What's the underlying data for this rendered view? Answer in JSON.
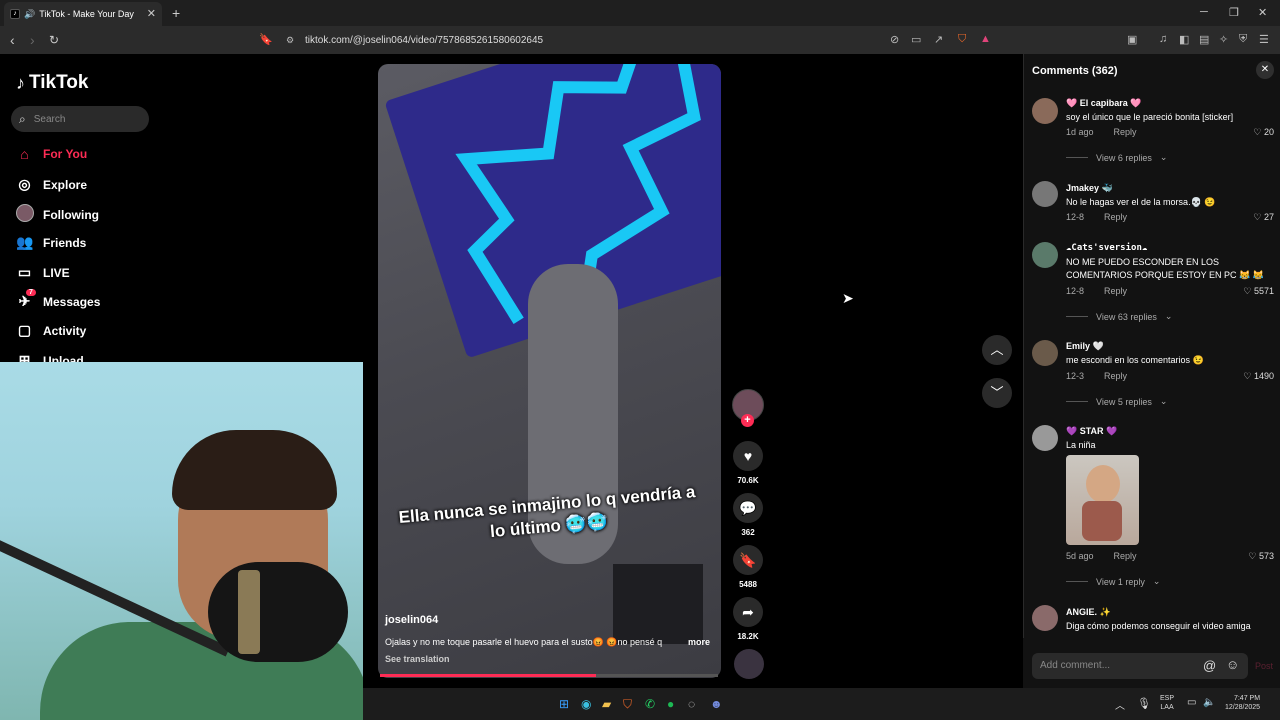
{
  "browser": {
    "tab_title": "TikTok - Make Your Day",
    "url": "tiktok.com/@joselin064/video/7578685261580602645"
  },
  "sidebar": {
    "logo": "TikTok",
    "search_placeholder": "Search",
    "items": [
      {
        "label": "For You",
        "icon": "home-icon",
        "active": true
      },
      {
        "label": "Explore",
        "icon": "compass-icon"
      },
      {
        "label": "Following",
        "icon": "avatar"
      },
      {
        "label": "Friends",
        "icon": "friends-icon"
      },
      {
        "label": "LIVE",
        "icon": "live-icon"
      },
      {
        "label": "Messages",
        "icon": "messages-icon",
        "badge": "7"
      },
      {
        "label": "Activity",
        "icon": "activity-icon"
      },
      {
        "label": "Upload",
        "icon": "upload-icon"
      }
    ]
  },
  "video": {
    "caption": "Ella nunca se inmajino lo q vendría a lo último 🥶🥶",
    "author": "joselin064",
    "description": "Ojalas y no me toque pasarle el huevo para el susto😡 😡no pensé q",
    "more": "more",
    "see_translation": "See translation",
    "progress": 0.64,
    "likes": "70.6K",
    "comments": "362",
    "saves": "5488",
    "shares": "18.2K"
  },
  "comments_panel": {
    "title": "Comments (362)",
    "add_placeholder": "Add comment...",
    "post_label": "Post",
    "items": [
      {
        "name": "🩷 El capibara 🩷",
        "text": "soy el único que le pareció bonita [sticker]",
        "time": "1d ago",
        "reply": "Reply",
        "likes": "20",
        "view_replies": "View 6 replies"
      },
      {
        "name": "Jmakey 🐳",
        "text": "No le hagas ver el de la morsa.💀 😉",
        "time": "12-8",
        "reply": "Reply",
        "likes": "27"
      },
      {
        "name": "☁Cats'sversion☁",
        "text": "NO ME PUEDO ESCONDER EN LOS COMENTARIOS PORQUE ESTOY EN PC 😹 😹",
        "time": "12-8",
        "reply": "Reply",
        "likes": "5571",
        "view_replies": "View 63 replies"
      },
      {
        "name": "Emily 🤍",
        "text": "me escondi en los comentarios 😉",
        "time": "12-3",
        "reply": "Reply",
        "likes": "1490",
        "view_replies": "View 5 replies"
      },
      {
        "name": "💜 STAR 💜",
        "text": "La niña",
        "time": "5d ago",
        "reply": "Reply",
        "likes": "573",
        "view_replies": "View 1 reply"
      },
      {
        "name": "ANGIE. ✨",
        "text": "Diga cómo podemos conseguir el video amiga"
      }
    ]
  },
  "taskbar": {
    "lang": "ESP",
    "lang_sub": "LAA",
    "time": "7:47 PM",
    "date": "12/28/2025"
  },
  "colors": {
    "accent": "#fe2c55",
    "background": "#000000"
  }
}
